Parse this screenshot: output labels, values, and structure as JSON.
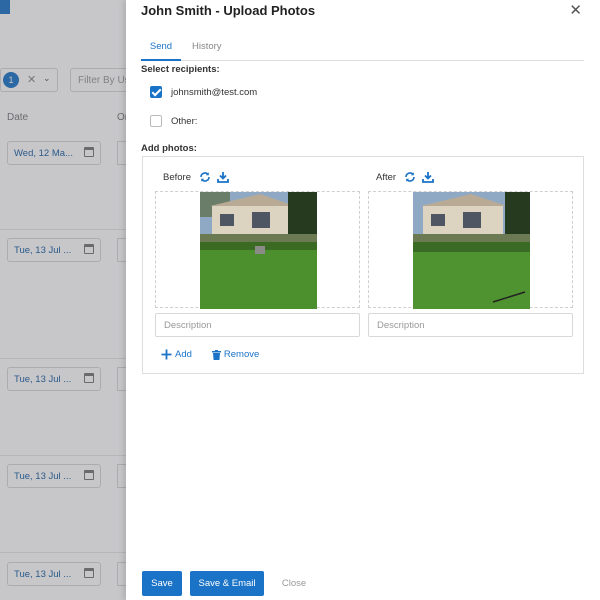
{
  "background": {
    "filter_count": "1",
    "filter_placeholder": "Filter By Us",
    "columns": [
      "Date",
      "Or"
    ],
    "rows": [
      {
        "date": "Wed, 12 Ma..."
      },
      {
        "date": "Tue, 13 Jul ..."
      },
      {
        "date": "Tue, 13 Jul ..."
      },
      {
        "date": "Tue, 13 Jul ..."
      },
      {
        "date": "Tue, 13 Jul ..."
      }
    ]
  },
  "modal": {
    "title": "John Smith - Upload Photos",
    "tabs": [
      {
        "label": "Send",
        "active": true
      },
      {
        "label": "History",
        "active": false
      }
    ],
    "recipients": {
      "label": "Select recipients:",
      "options": [
        {
          "label": "johnsmith@test.com",
          "checked": true
        },
        {
          "label": "Other:",
          "checked": false
        }
      ]
    },
    "photos": {
      "label": "Add photos:",
      "slots": [
        {
          "label": "Before",
          "description_placeholder": "Description"
        },
        {
          "label": "After",
          "description_placeholder": "Description"
        }
      ],
      "add_label": "Add",
      "remove_label": "Remove"
    },
    "buttons": {
      "save": "Save",
      "save_email": "Save & Email",
      "close": "Close"
    }
  },
  "colors": {
    "accent": "#1a73c7"
  }
}
